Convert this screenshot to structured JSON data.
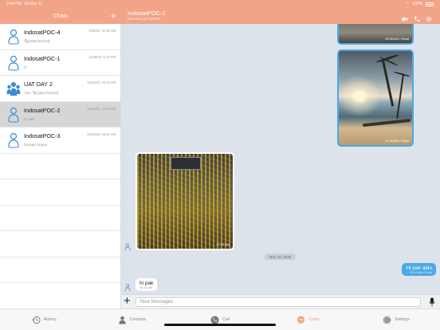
{
  "status": {
    "time": "2:44 PM",
    "date": "Fri Dec 11",
    "battery": "100%"
  },
  "sidebar": {
    "title": "Chats",
    "items": [
      {
        "name": "IndosatPOC-4",
        "time": "12/8/20, 11:28 AM",
        "preview": "[attachment]",
        "attach": true
      },
      {
        "name": "IndosatPOC-1",
        "time": "11/30/20, 6:19 PM",
        "preview": "hi",
        "attach": false
      },
      {
        "name": "UAT DAY 2",
        "time": "11/19/20, 10:18 AM",
        "preview_prefix": "You:",
        "preview": "[attachment]",
        "attach": true
      },
      {
        "name": "IndosatPOC-2",
        "time": "11/19/20, 10:15 AM",
        "preview": "hi pak",
        "attach": false
      },
      {
        "name": "IndosatPOC-3",
        "time": "11/19/20, 10:21 AM",
        "preview": "berapa begitu",
        "attach": false
      }
    ]
  },
  "chat": {
    "title": "IndosatPOC-2",
    "subtitle": "last seen at 7:43 PM",
    "img1_meta": "10:08 AM • Read",
    "img2_meta": "10:08 AM • Read",
    "img3_meta": "10:13 AM",
    "date_chip": "Nov 19, 2020",
    "outgoing": {
      "text": "Hi pak aldo",
      "meta": "10:14 AM • Read"
    },
    "incoming": {
      "text": "hi pak",
      "meta": "10:14 AM"
    },
    "input_placeholder": "New Messages"
  },
  "tabs": [
    {
      "label": "History",
      "icon": "history-icon"
    },
    {
      "label": "Contacts",
      "icon": "contacts-icon"
    },
    {
      "label": "Call",
      "icon": "phone-icon"
    },
    {
      "label": "Chats",
      "icon": "chat-icon",
      "active": true
    },
    {
      "label": "Settings",
      "icon": "gear-icon"
    }
  ],
  "colors": {
    "accent": "#f2a488",
    "bubble_out": "#4aa9e8",
    "chat_bg": "#dde3ea"
  }
}
